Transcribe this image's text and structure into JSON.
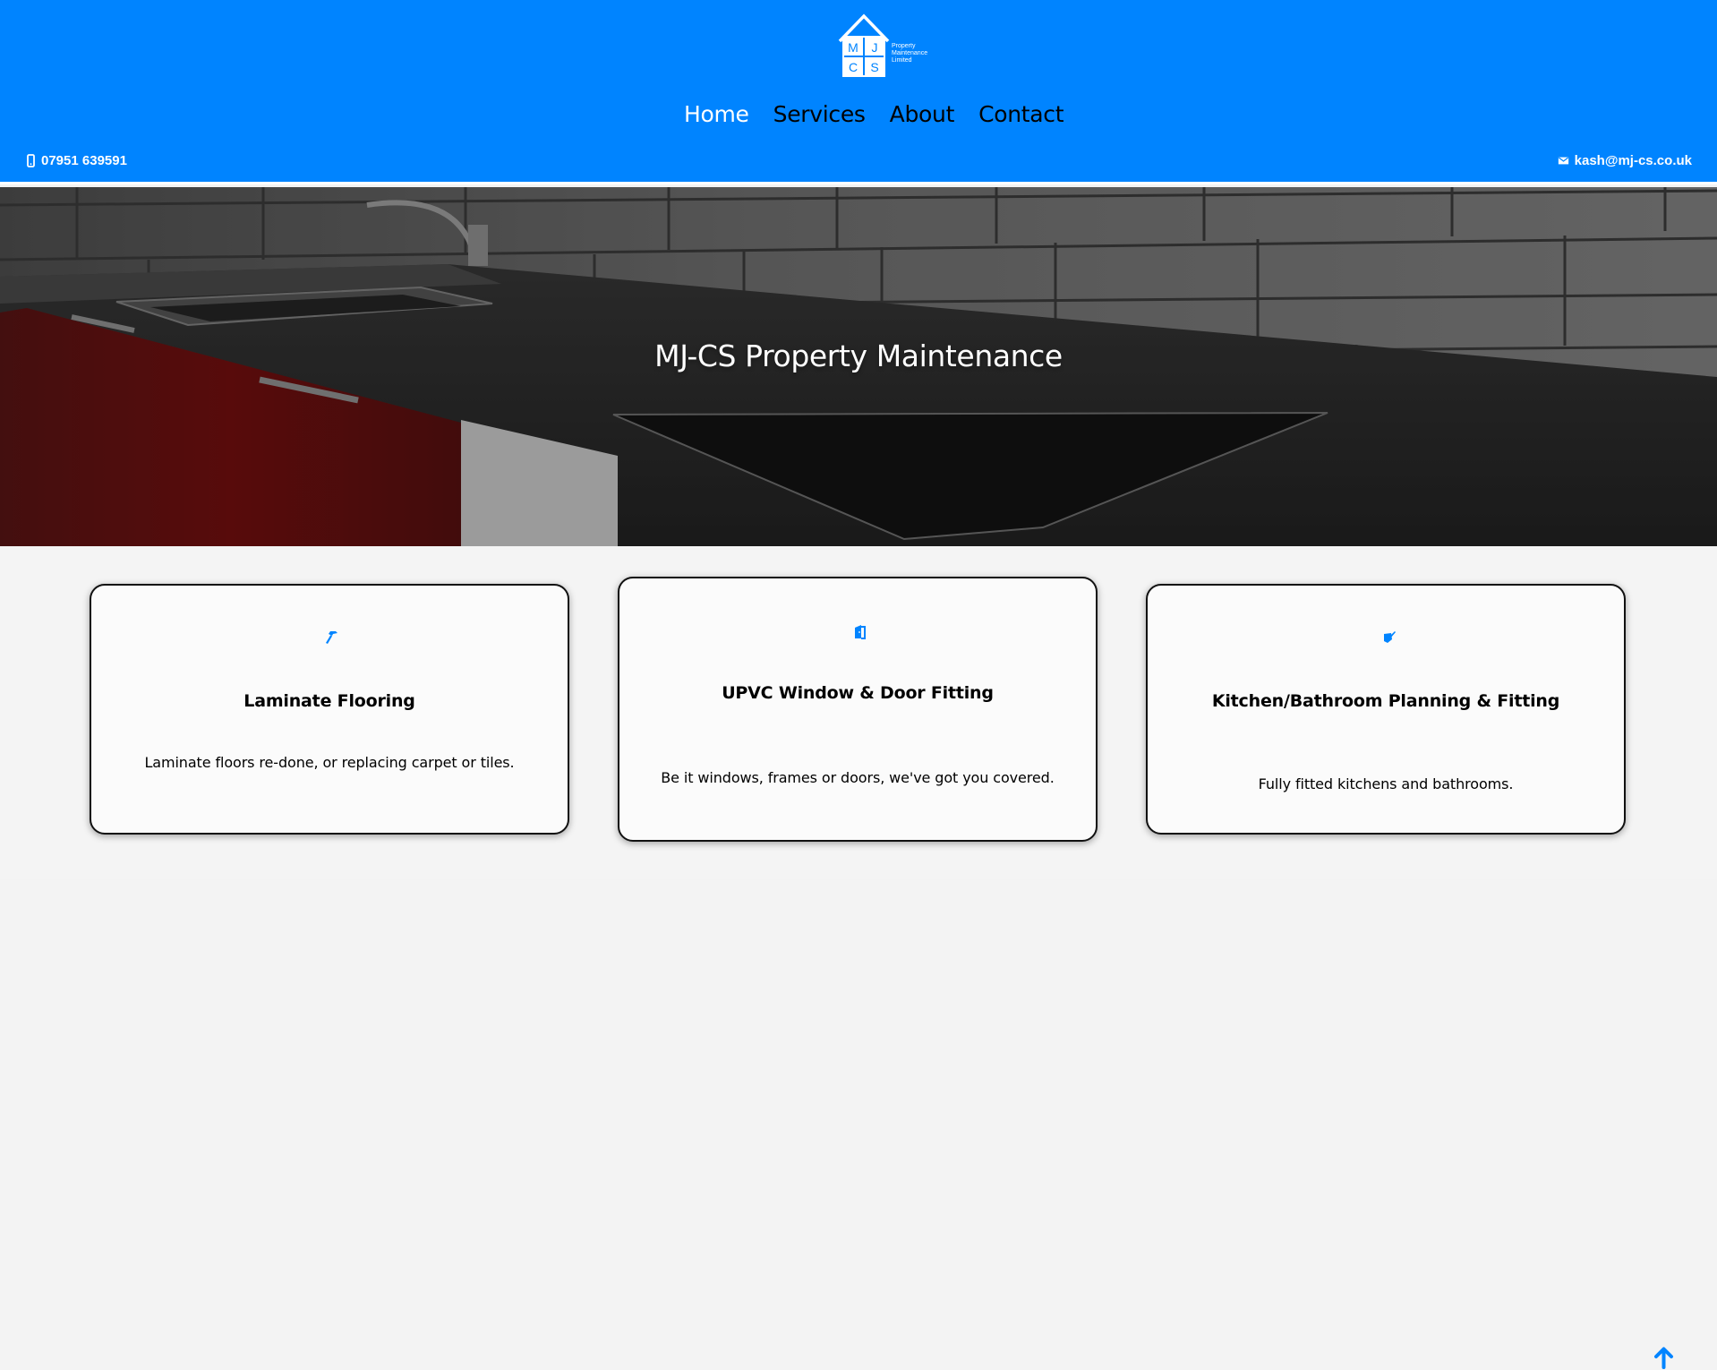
{
  "brand": {
    "logo_letters": [
      "M",
      "J",
      "C",
      "S"
    ],
    "logo_text_lines": [
      "Property",
      "Maintenance",
      "Limited"
    ],
    "color": "#0084ff"
  },
  "nav": {
    "items": [
      {
        "label": "Home",
        "active": true
      },
      {
        "label": "Services",
        "active": false
      },
      {
        "label": "About",
        "active": false
      },
      {
        "label": "Contact",
        "active": false
      }
    ]
  },
  "contact": {
    "phone": "07951 639591",
    "email": "kash@mj-cs.co.uk",
    "phone_icon": "mobile-phone-icon",
    "email_icon": "envelope-icon"
  },
  "hero": {
    "title": "MJ-CS Property Maintenance"
  },
  "services": [
    {
      "icon": "hammer-icon",
      "title": "Laminate Flooring",
      "description": "Laminate floors re-done, or replacing carpet or tiles."
    },
    {
      "icon": "door-icon",
      "title": "UPVC Window & Door Fitting",
      "description": "Be it windows, frames or doors, we've got you covered."
    },
    {
      "icon": "paint-brush-icon",
      "title": "Kitchen/Bathroom Planning & Fitting",
      "description": "Fully fitted kitchens and bathrooms."
    }
  ],
  "back_to_top_icon": "arrow-up-icon"
}
